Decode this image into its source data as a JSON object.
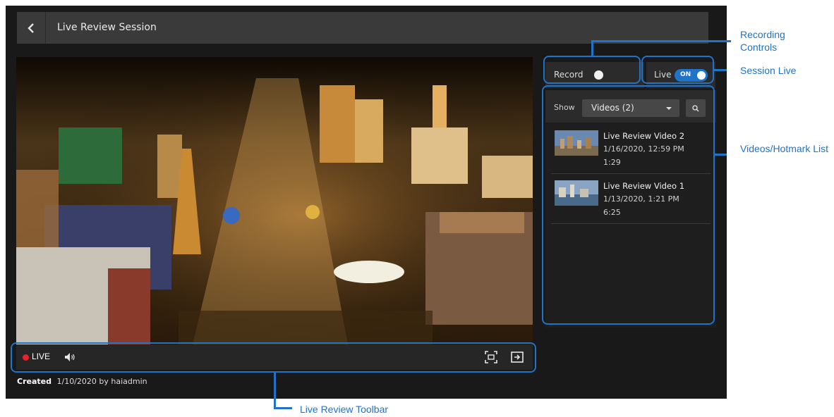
{
  "header": {
    "title": "Live Review Session"
  },
  "toolbar": {
    "live_label": "LIVE"
  },
  "footer": {
    "created_label": "Created",
    "created_value": "1/10/2020 by haiadmin"
  },
  "controls": {
    "record_label": "Record",
    "live_label": "Live",
    "live_switch_text": "ON",
    "live_switch_on": true,
    "record_on": false
  },
  "list": {
    "show_label": "Show",
    "filter_value": "Videos (2)",
    "items": [
      {
        "name": "Live Review Video 2",
        "date": "1/16/2020, 12:59 PM",
        "duration": "1:29"
      },
      {
        "name": "Live Review Video 1",
        "date": "1/13/2020, 1:21 PM",
        "duration": "6:25"
      }
    ]
  },
  "annotations": {
    "recording_controls": "Recording Controls",
    "session_live": "Session Live",
    "videos_hotmark_list": "Videos/Hotmark List",
    "live_review_toolbar": "Live Review Toolbar"
  },
  "colors": {
    "accent": "#1f73c8",
    "live_red": "#e8222a",
    "app_bg": "#191919"
  },
  "icons": [
    "chevron-left-icon",
    "volume-icon",
    "fullscreen-icon",
    "exit-icon",
    "search-icon",
    "caret-down-icon"
  ]
}
